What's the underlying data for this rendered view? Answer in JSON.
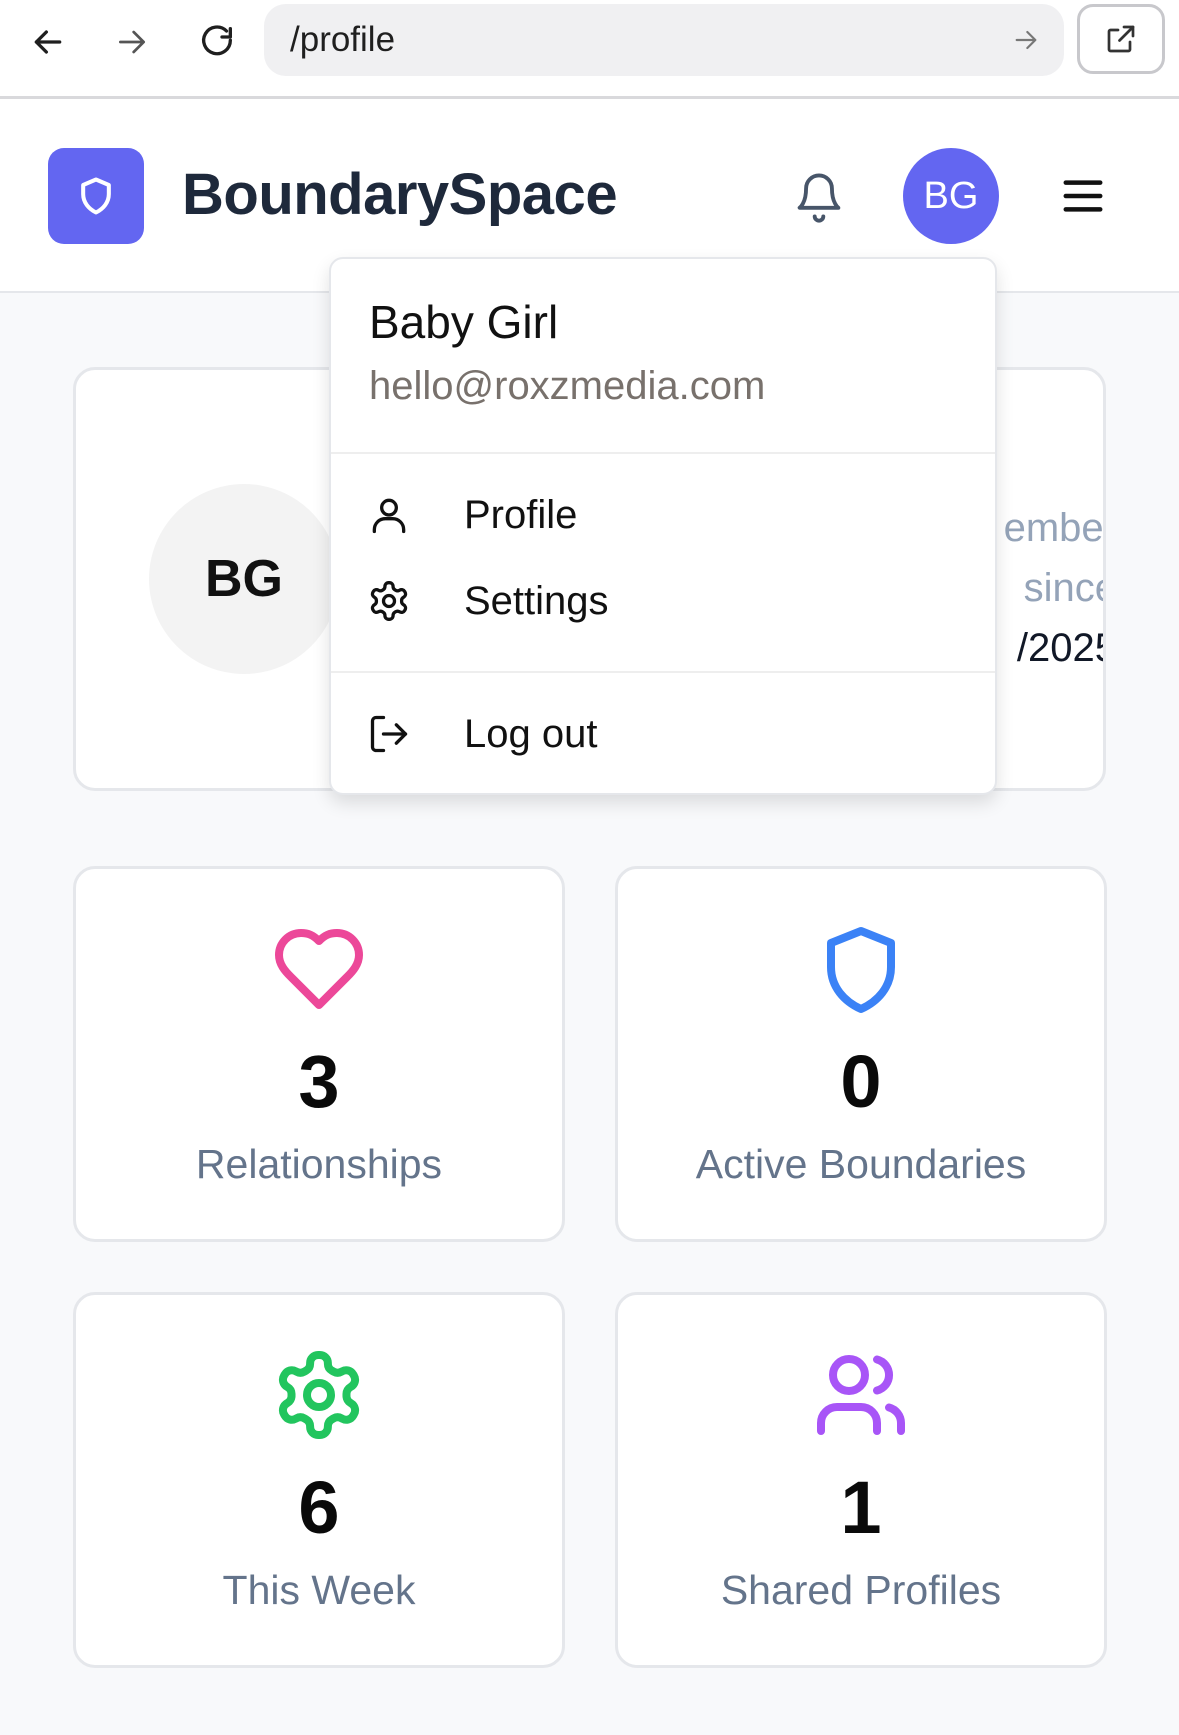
{
  "browser": {
    "url": "/profile"
  },
  "header": {
    "brand": "BoundarySpace",
    "avatar_initials": "BG",
    "accent": "#6366f1"
  },
  "dropdown": {
    "name": "Baby Girl",
    "email": "hello@roxzmedia.com",
    "items": [
      {
        "label": "Profile",
        "icon": "user-icon"
      },
      {
        "label": "Settings",
        "icon": "gear-icon"
      },
      {
        "label": "Log out",
        "icon": "logout-icon"
      }
    ]
  },
  "profile": {
    "avatar_initials": "BG",
    "member_line1": "ember",
    "member_line2": "since",
    "member_date": "/2025"
  },
  "stats": [
    {
      "value": "3",
      "label": "Relationships",
      "icon": "heart-icon",
      "color": "#ec4899"
    },
    {
      "value": "0",
      "label": "Active Boundaries",
      "icon": "shield-icon",
      "color": "#3b82f6"
    },
    {
      "value": "6",
      "label": "This Week",
      "icon": "gear-icon",
      "color": "#22c55e"
    },
    {
      "value": "1",
      "label": "Shared Profiles",
      "icon": "users-icon",
      "color": "#a855f7"
    }
  ]
}
